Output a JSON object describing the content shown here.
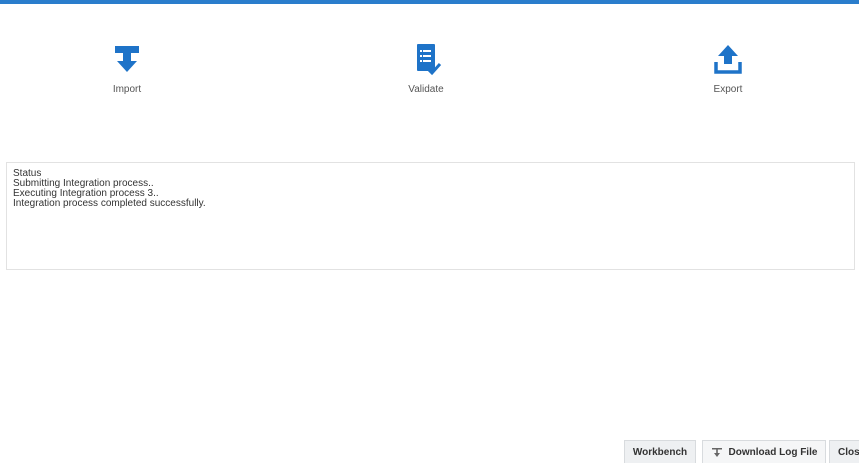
{
  "colors": {
    "accent": "#2a7dcc",
    "icon": "#1e73c8"
  },
  "actions": [
    {
      "label": "Import",
      "icon": "import-icon"
    },
    {
      "label": "Validate",
      "icon": "validate-icon"
    },
    {
      "label": "Export",
      "icon": "export-icon"
    }
  ],
  "status": {
    "lines": [
      "Status",
      "Submitting Integration process..",
      "Executing Integration process 3..",
      "Integration process completed successfully."
    ]
  },
  "footer": {
    "workbench_label": "Workbench",
    "download_label": "Download Log File",
    "close_label": "Clos"
  }
}
